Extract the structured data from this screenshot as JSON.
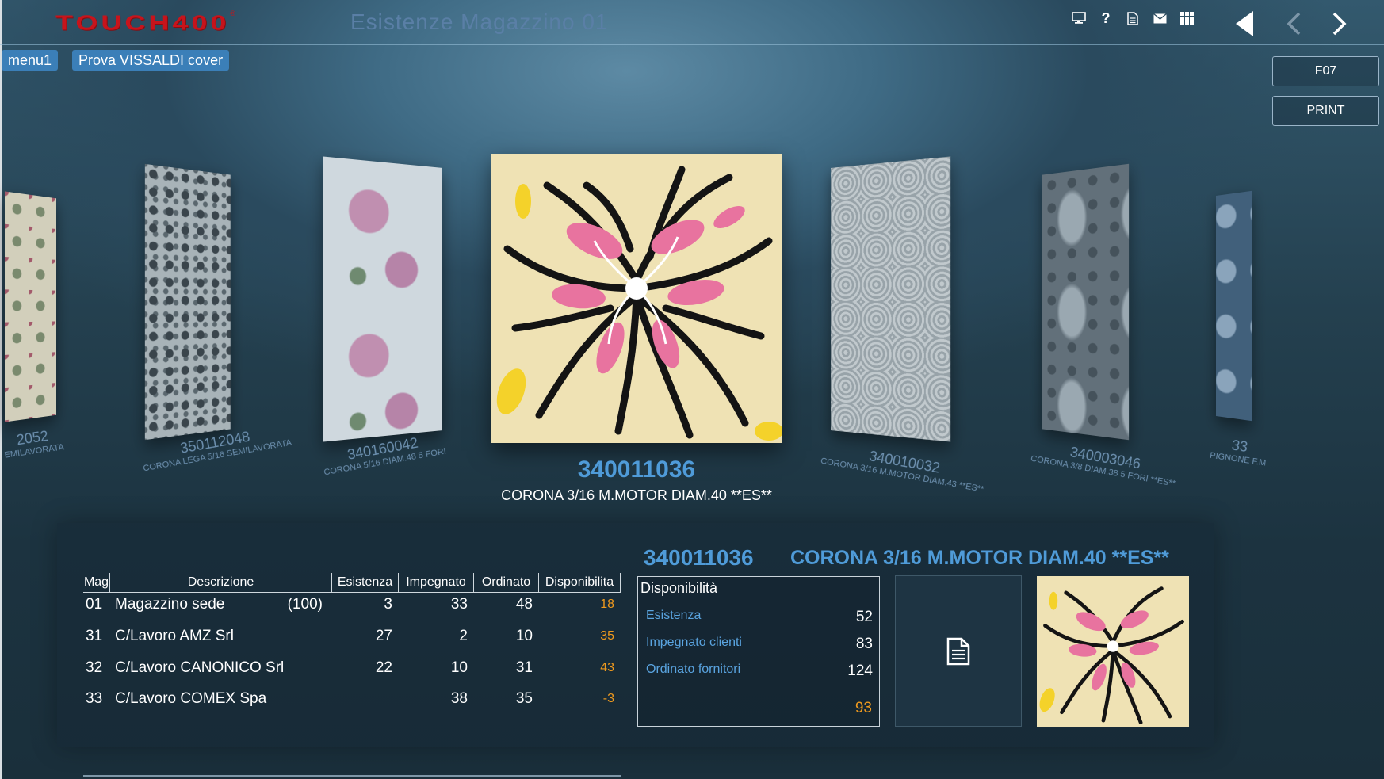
{
  "header": {
    "logo": "TOUCH400",
    "logo_mark": "®",
    "title": "Esistenze Magazzino 01",
    "icons": [
      "monitor-icon",
      "help-icon",
      "document-icon",
      "mail-icon",
      "grid-icon"
    ],
    "nav": [
      "back-triangle-icon",
      "chevron-left-icon",
      "chevron-right-icon"
    ]
  },
  "menu": {
    "menu1_label": "menu1",
    "menu2_label": "Prova VISSALDI cover"
  },
  "function_keys": {
    "f07": "F07",
    "print": "PRINT"
  },
  "carousel": {
    "items": [
      {
        "code": "2052",
        "desc": "EMILAVORATA"
      },
      {
        "code": "350112048",
        "desc": "CORONA LEGA 5/16 SEMILAVORATA"
      },
      {
        "code": "340160042",
        "desc": "CORONA 5/16 DIAM.48 5 FORI"
      },
      {
        "code": "340010032",
        "desc": "CORONA 3/16 M.MOTOR DIAM.43 **ES**"
      },
      {
        "code": "340003046",
        "desc": "CORONA 3/8 DIAM.38 5 FORI **ES**"
      },
      {
        "code": "33",
        "desc": "PIGNONE F.M"
      }
    ],
    "selected": {
      "code": "340011036",
      "desc": "CORONA 3/16 M.MOTOR DIAM.40  **ES**"
    }
  },
  "table": {
    "headers": [
      "Mag",
      "Descrizione",
      "Esistenza",
      "Impegnato",
      "Ordinato",
      "Disponibilita"
    ],
    "rows": [
      {
        "mag": "01",
        "desc": "Magazzino sede",
        "note": "(100)",
        "esistenza": "3",
        "impegnato": "33",
        "ordinato": "48",
        "disp": "18"
      },
      {
        "mag": "31",
        "desc": "C/Lavoro AMZ Srl",
        "note": "",
        "esistenza": "27",
        "impegnato": "2",
        "ordinato": "10",
        "disp": "35"
      },
      {
        "mag": "32",
        "desc": "C/Lavoro CANONICO Srl",
        "note": "",
        "esistenza": "22",
        "impegnato": "10",
        "ordinato": "31",
        "disp": "43"
      },
      {
        "mag": "33",
        "desc": "C/Lavoro COMEX Spa",
        "note": "",
        "esistenza": "",
        "impegnato": "38",
        "ordinato": "35",
        "disp": "-3"
      }
    ]
  },
  "detail": {
    "code": "340011036",
    "desc": "CORONA 3/16 M.MOTOR DIAM.40  **ES**",
    "disponibilita": {
      "title": "Disponibilità",
      "lines": [
        {
          "label": "Esistenza",
          "value": "52"
        },
        {
          "label": "Impegnato clienti",
          "value": "83"
        },
        {
          "label": "Ordinato fornitori",
          "value": "124"
        }
      ],
      "total": "93"
    }
  },
  "colors": {
    "accent_blue": "#4f9bd8",
    "label_blue": "#5aa4e0",
    "orange": "#ef9a1e",
    "logo_red": "#c7141c",
    "menu_button": "#3b7fb8"
  }
}
